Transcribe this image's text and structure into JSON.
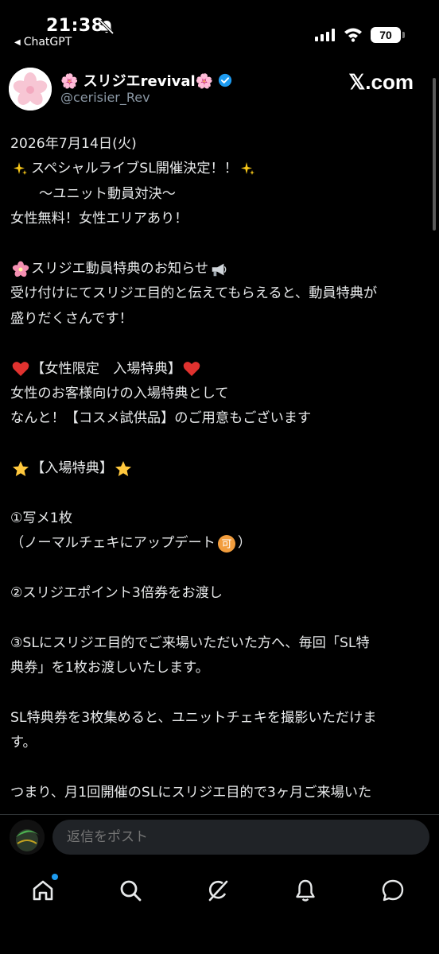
{
  "status_bar": {
    "time": "21:38",
    "back_app": "ChatGPT",
    "battery": "70"
  },
  "header": {
    "display_name": "🌸 スリジエrevival🌸",
    "handle": "@cerisier_Rev",
    "site": "𝕏.com",
    "verified_color": "#1d9bf0"
  },
  "tweet": {
    "lines": [
      "2026年7月14日(火)",
      "スペシャルライブSL開催決定！！",
      "〜ユニット動員対決〜",
      "女性無料！女性エリアあり！",
      "",
      "スリジエ動員特典のお知らせ",
      "受け付けにてスリジエ目的と伝えてもらえると、動員特典が",
      "盛りだくさんです！",
      "",
      "【女性限定　入場特典】",
      "女性のお客様向けの入場特典として",
      "なんと！【コスメ試供品】のご用意もございます",
      "",
      "【入場特典】",
      "",
      "①写メ1枚",
      "（ノーマルチェキにアップデート",
      "）",
      "",
      "②スリジエポイント3倍券をお渡し",
      "",
      "③SLにスリジエ目的でご来場いただいた方へ、毎回「SL特",
      "典券」を1枚お渡しいたします。",
      "",
      "SL特典券を3枚集めると、ユニットチェキを撮影いただけま",
      "す。",
      "",
      "つまり、月1回開催のSLにスリジエ目的で3ヶ月ご来場いた"
    ],
    "badge_char": "可"
  },
  "reply": {
    "placeholder": "返信をポスト"
  },
  "tabbar": {
    "items": [
      "home-icon",
      "search-icon",
      "grok-icon",
      "notifications-icon",
      "messages-icon"
    ],
    "accent": "#1d9bf0"
  }
}
